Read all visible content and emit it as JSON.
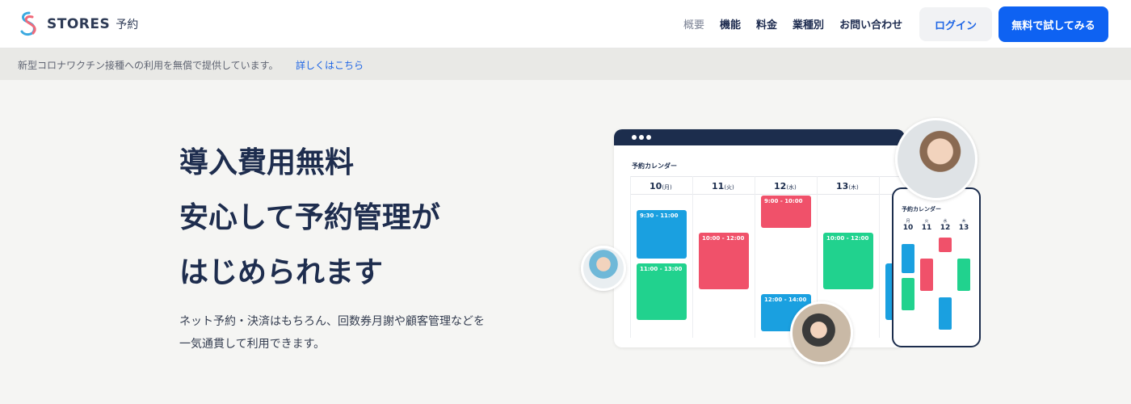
{
  "brand": {
    "name": "STORES",
    "sub": "予約"
  },
  "nav": {
    "items": [
      {
        "label": "概要",
        "muted": true
      },
      {
        "label": "機能",
        "muted": false
      },
      {
        "label": "料金",
        "muted": false
      },
      {
        "label": "業種別",
        "muted": false
      },
      {
        "label": "お問い合わせ",
        "muted": false
      }
    ]
  },
  "header": {
    "login": "ログイン",
    "trial": "無料で試してみる"
  },
  "notice": {
    "text": "新型コロナワクチン接種への利用を無償で提供しています。",
    "link": "詳しくはこちら"
  },
  "hero": {
    "title_lines": [
      "導入費用無料",
      "安心して予約管理が",
      "はじめられます"
    ],
    "sub_lines": [
      "ネット予約・決済はもちろん、回数券月謝や顧客管理などを",
      "一気通貫して利用できます。"
    ]
  },
  "calendar": {
    "title": "予約カレンダー",
    "days": [
      {
        "num": "10",
        "wd": "(月)"
      },
      {
        "num": "11",
        "wd": "(火)"
      },
      {
        "num": "12",
        "wd": "(水)"
      },
      {
        "num": "13",
        "wd": "(木)"
      }
    ],
    "events": [
      {
        "time": "9:30 - 11:00",
        "color": "blue"
      },
      {
        "time": "11:00 - 13:00",
        "color": "green"
      },
      {
        "time": "10:00 - 12:00",
        "color": "red"
      },
      {
        "time": "9:00 - 10:00",
        "color": "red"
      },
      {
        "time": "12:00 - 14:00",
        "color": "blue"
      },
      {
        "time": "10:00 - 12:00",
        "color": "green"
      }
    ]
  },
  "phone": {
    "title": "予約カレンダー",
    "days": [
      {
        "num": "10",
        "wd": "月"
      },
      {
        "num": "11",
        "wd": "火"
      },
      {
        "num": "12",
        "wd": "水"
      },
      {
        "num": "13",
        "wd": "木"
      }
    ]
  },
  "colors": {
    "primary": "#0e62f2",
    "navy": "#1c2d4d",
    "blue": "#1aa0e0",
    "red": "#f0516a",
    "green": "#21d28e"
  }
}
